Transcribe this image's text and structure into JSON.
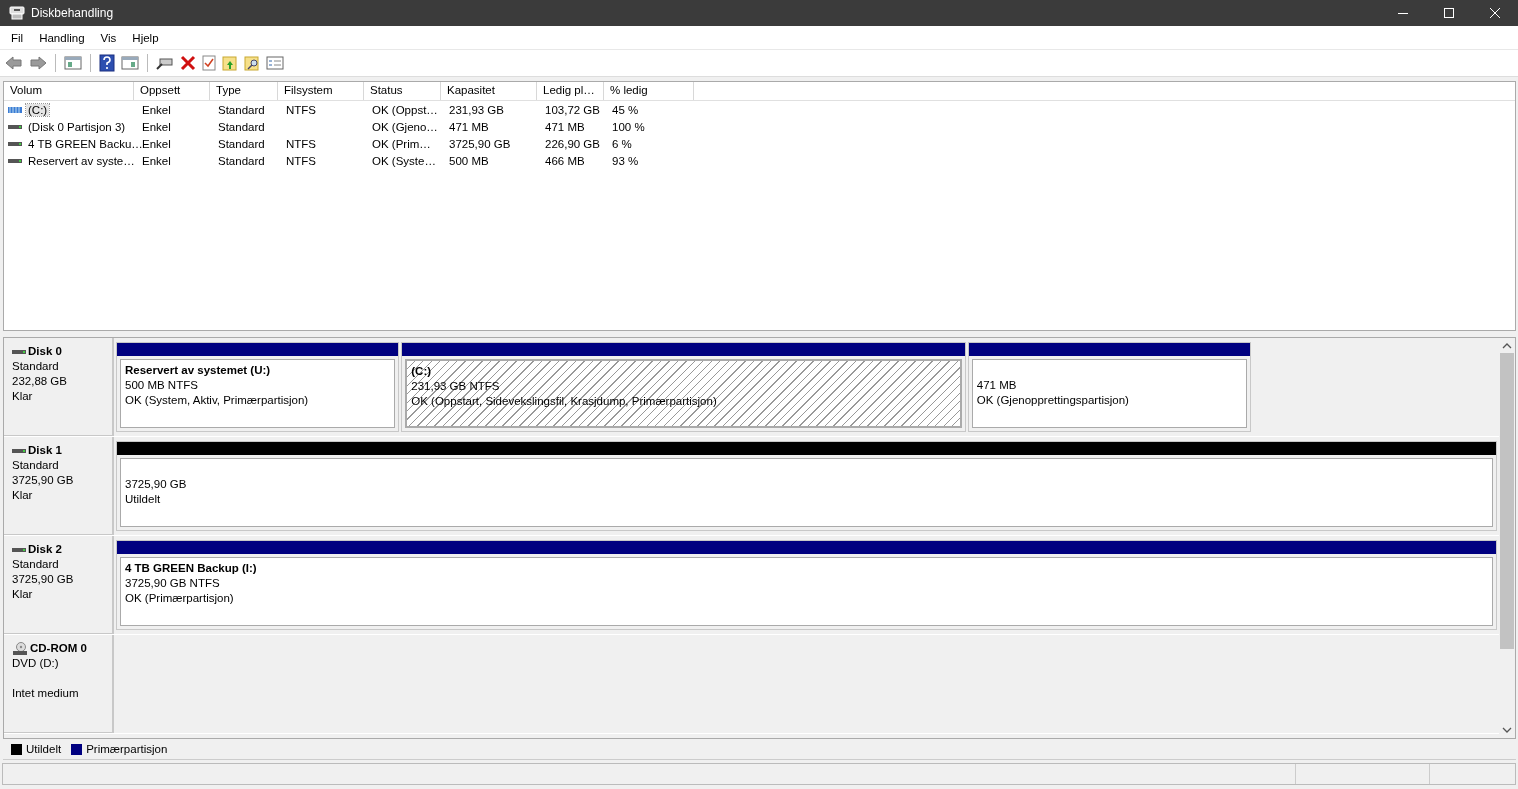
{
  "window": {
    "title": "Diskbehandling"
  },
  "menu": [
    "Fil",
    "Handling",
    "Vis",
    "Hjelp"
  ],
  "volumes": {
    "columns": [
      "Volum",
      "Oppsett",
      "Type",
      "Filsystem",
      "Status",
      "Kapasitet",
      "Ledig pl…",
      "% ledig"
    ],
    "rows": [
      {
        "kind": "system",
        "selected": true,
        "cells": [
          "(C:)",
          "Enkel",
          "Standard",
          "NTFS",
          "OK (Oppst…",
          "231,93 GB",
          "103,72 GB",
          "45 %"
        ]
      },
      {
        "kind": "plain",
        "selected": false,
        "cells": [
          "(Disk 0 Partisjon 3)",
          "Enkel",
          "Standard",
          "",
          "OK (Gjeno…",
          "471 MB",
          "471 MB",
          "100 %"
        ]
      },
      {
        "kind": "plain",
        "selected": false,
        "cells": [
          "4 TB GREEN Backu…",
          "Enkel",
          "Standard",
          "NTFS",
          "OK (Prim…",
          "3725,90 GB",
          "226,90 GB",
          "6 %"
        ]
      },
      {
        "kind": "plain",
        "selected": false,
        "cells": [
          "Reservert av syste…",
          "Enkel",
          "Standard",
          "NTFS",
          "OK (Syste…",
          "500 MB",
          "466 MB",
          "93 %"
        ]
      }
    ]
  },
  "disks": [
    {
      "kind": "disk",
      "name": "Disk 0",
      "lines": [
        "Standard",
        "232,88 GB",
        "Klar"
      ],
      "partitions": [
        {
          "kind": "primary",
          "selected": false,
          "title": "Reservert av systemet  (U:)",
          "lines": [
            "500 MB NTFS",
            "OK (System, Aktiv, Primærpartisjon)"
          ]
        },
        {
          "kind": "primary",
          "selected": true,
          "title": "(C:)",
          "lines": [
            "231,93 GB NTFS",
            "OK (Oppstart, Sidevekslingsfil, Krasjdump, Primærpartisjon)"
          ]
        },
        {
          "kind": "primary",
          "selected": false,
          "lines": [
            "471 MB",
            "OK (Gjenopprettingspartisjon)"
          ]
        }
      ]
    },
    {
      "kind": "disk",
      "name": "Disk 1",
      "lines": [
        "Standard",
        "3725,90 GB",
        "Klar"
      ],
      "partitions": [
        {
          "kind": "unallocated",
          "selected": false,
          "lines": [
            "3725,90 GB",
            "Utildelt"
          ]
        }
      ]
    },
    {
      "kind": "disk",
      "name": "Disk 2",
      "lines": [
        "Standard",
        "3725,90 GB",
        "Klar"
      ],
      "partitions": [
        {
          "kind": "primary",
          "selected": false,
          "title": "4 TB GREEN Backup  (I:)",
          "lines": [
            "3725,90 GB NTFS",
            "OK (Primærpartisjon)"
          ]
        }
      ]
    },
    {
      "kind": "cdrom",
      "name": "CD-ROM 0",
      "lines": [
        "DVD (D:)",
        "Intet medium"
      ]
    }
  ],
  "legend": [
    {
      "label": "Utildelt",
      "color": "#000000"
    },
    {
      "label": "Primærpartisjon",
      "color": "#000080"
    }
  ]
}
